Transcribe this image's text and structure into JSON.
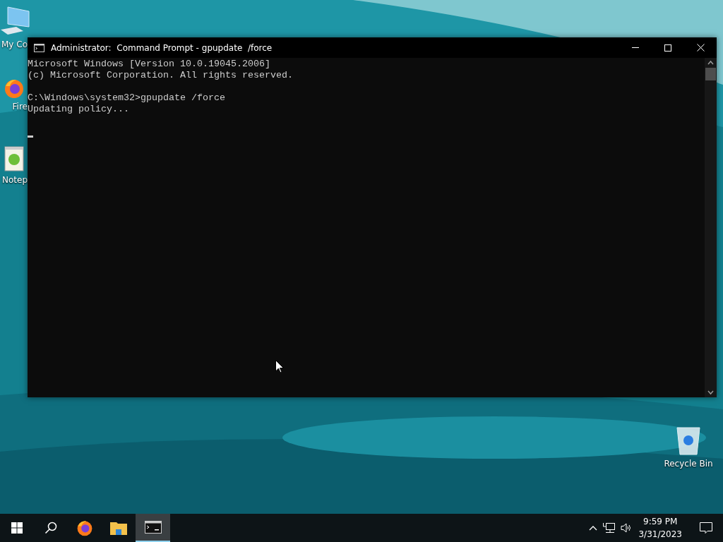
{
  "desktop_icons": [
    {
      "kind": "computer",
      "label": "My Co"
    },
    {
      "kind": "firefox",
      "label": "Fire"
    },
    {
      "kind": "notepad",
      "label": "Notep"
    },
    {
      "kind": "recycle",
      "label": "Recycle Bin"
    }
  ],
  "window": {
    "title": "Administrator:  Command Prompt - gpupdate  /force",
    "console_blocks": [
      [
        "Microsoft Windows [Version 10.0.19045.2006]",
        "(c) Microsoft Corporation. All rights reserved."
      ],
      [
        "C:\\Windows\\system32>gpupdate /force",
        "Updating policy..."
      ]
    ]
  },
  "taskbar": {
    "items": [
      {
        "kind": "start",
        "active": false
      },
      {
        "kind": "search",
        "active": false
      },
      {
        "kind": "firefox",
        "active": false
      },
      {
        "kind": "explorer",
        "active": false
      },
      {
        "kind": "cmd",
        "active": true
      }
    ],
    "time": "9:59 PM",
    "date": "3/31/2023"
  }
}
